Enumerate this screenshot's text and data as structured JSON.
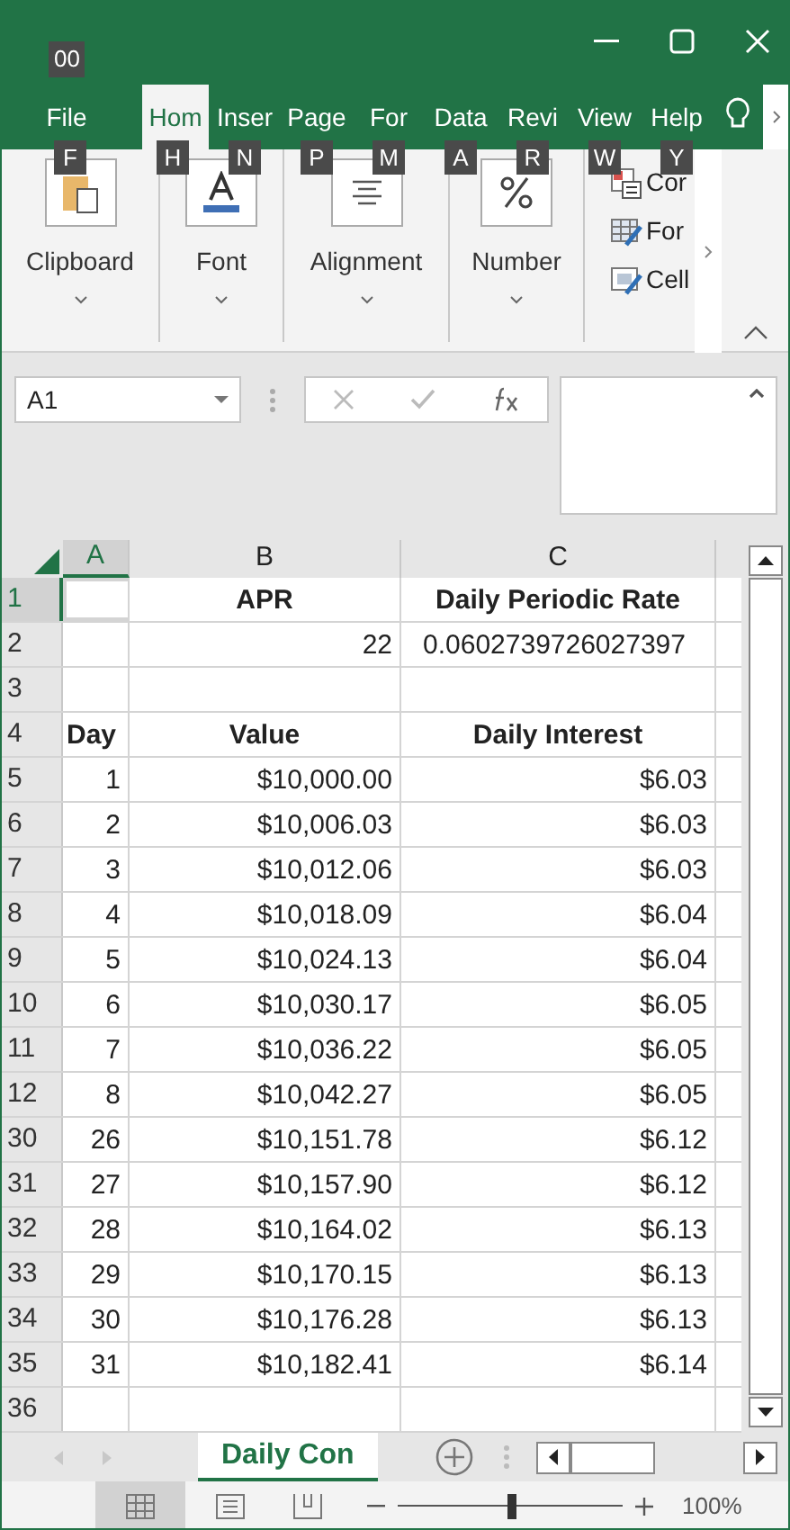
{
  "quick_access_badge": "00",
  "ribbon_tabs": [
    {
      "label": "File",
      "selected": false,
      "keytip": "F"
    },
    {
      "label": "Hom",
      "selected": true,
      "keytip": "H"
    },
    {
      "label": "Inser",
      "selected": false,
      "keytip": "N"
    },
    {
      "label": "Page",
      "selected": false,
      "keytip": "P"
    },
    {
      "label": "For",
      "selected": false,
      "keytip": "M"
    },
    {
      "label": "Data",
      "selected": false,
      "keytip": "A"
    },
    {
      "label": "Revi",
      "selected": false,
      "keytip": "R"
    },
    {
      "label": "View",
      "selected": false,
      "keytip": "W"
    },
    {
      "label": "Help",
      "selected": false,
      "keytip": "Y"
    }
  ],
  "ribbon_groups": [
    {
      "label": "Clipboard",
      "kind": "clipboard"
    },
    {
      "label": "Font",
      "kind": "font"
    },
    {
      "label": "Alignment",
      "kind": "alignment"
    },
    {
      "label": "Number",
      "kind": "number"
    }
  ],
  "styles_items": [
    {
      "label": "Cor",
      "kind": "conditional"
    },
    {
      "label": "For",
      "kind": "table"
    },
    {
      "label": "Cell",
      "kind": "cell"
    }
  ],
  "name_box": "A1",
  "columns": [
    {
      "label": "A",
      "selected": true
    },
    {
      "label": "B",
      "selected": false
    },
    {
      "label": "C",
      "selected": false
    }
  ],
  "rows": [
    {
      "header": "1",
      "selected": true,
      "kind": "heading",
      "cells": [
        "",
        "APR",
        "Daily Periodic Rate"
      ]
    },
    {
      "header": "2",
      "selected": false,
      "kind": "value",
      "cells": [
        "",
        "22",
        "0.0602739726027397"
      ]
    },
    {
      "header": "3",
      "selected": false,
      "kind": "data",
      "cells": [
        "",
        "",
        ""
      ]
    },
    {
      "header": "4",
      "selected": false,
      "kind": "heading",
      "cells": [
        "Day",
        "Value",
        "Daily Interest"
      ]
    },
    {
      "header": "5",
      "selected": false,
      "kind": "data",
      "cells": [
        "1",
        "$10,000.00",
        "$6.03"
      ]
    },
    {
      "header": "6",
      "selected": false,
      "kind": "data",
      "cells": [
        "2",
        "$10,006.03",
        "$6.03"
      ]
    },
    {
      "header": "7",
      "selected": false,
      "kind": "data",
      "cells": [
        "3",
        "$10,012.06",
        "$6.03"
      ]
    },
    {
      "header": "8",
      "selected": false,
      "kind": "data",
      "cells": [
        "4",
        "$10,018.09",
        "$6.04"
      ]
    },
    {
      "header": "9",
      "selected": false,
      "kind": "data",
      "cells": [
        "5",
        "$10,024.13",
        "$6.04"
      ]
    },
    {
      "header": "10",
      "selected": false,
      "kind": "data",
      "cells": [
        "6",
        "$10,030.17",
        "$6.05"
      ]
    },
    {
      "header": "11",
      "selected": false,
      "kind": "data",
      "cells": [
        "7",
        "$10,036.22",
        "$6.05"
      ]
    },
    {
      "header": "12",
      "selected": false,
      "kind": "data",
      "cells": [
        "8",
        "$10,042.27",
        "$6.05"
      ]
    },
    {
      "header": "30",
      "selected": false,
      "kind": "data",
      "cells": [
        "26",
        "$10,151.78",
        "$6.12"
      ]
    },
    {
      "header": "31",
      "selected": false,
      "kind": "data",
      "cells": [
        "27",
        "$10,157.90",
        "$6.12"
      ]
    },
    {
      "header": "32",
      "selected": false,
      "kind": "data",
      "cells": [
        "28",
        "$10,164.02",
        "$6.13"
      ]
    },
    {
      "header": "33",
      "selected": false,
      "kind": "data",
      "cells": [
        "29",
        "$10,170.15",
        "$6.13"
      ]
    },
    {
      "header": "34",
      "selected": false,
      "kind": "data",
      "cells": [
        "30",
        "$10,176.28",
        "$6.13"
      ]
    },
    {
      "header": "35",
      "selected": false,
      "kind": "data",
      "cells": [
        "31",
        "$10,182.41",
        "$6.14"
      ]
    },
    {
      "header": "36",
      "selected": false,
      "kind": "data",
      "cells": [
        "",
        "",
        ""
      ]
    }
  ],
  "sheet_tabs": [
    {
      "label": "Daily Con",
      "selected": true
    }
  ],
  "zoom": {
    "level": 0.5,
    "reading": "100%"
  }
}
